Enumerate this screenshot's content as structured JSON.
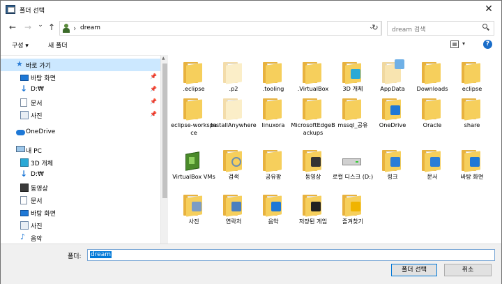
{
  "window": {
    "title": "폴더 선택",
    "close_glyph": "✕"
  },
  "nav": {
    "back_glyph": "←",
    "forward_glyph": "→",
    "dropdown_glyph": "⌄",
    "up_glyph": "↑"
  },
  "address": {
    "separator": "›",
    "path": "dream",
    "dropdown_glyph": "⌄",
    "refresh_glyph": "↻"
  },
  "search": {
    "placeholder": "dream 검색"
  },
  "toolbar": {
    "organize_label": "구성 ▾",
    "new_folder_label": "새 폴더",
    "view_dropdown": "▾",
    "help_label": "?"
  },
  "sidebar": {
    "items": [
      {
        "label": "바로 가기",
        "icon": "star-icon",
        "selected": true
      },
      {
        "label": "바탕 화면",
        "icon": "desktop-icon",
        "pinned": true
      },
      {
        "label": "D:₩",
        "icon": "download-icon",
        "pinned": true
      },
      {
        "label": "문서",
        "icon": "document-icon",
        "pinned": true
      },
      {
        "label": "사진",
        "icon": "picture-icon",
        "pinned": true
      },
      {
        "label": "OneDrive",
        "icon": "cloud-icon"
      },
      {
        "label": "내 PC",
        "icon": "pc-icon"
      },
      {
        "label": "3D 개체",
        "icon": "cube-icon"
      },
      {
        "label": "D:₩",
        "icon": "download-icon"
      },
      {
        "label": "동영상",
        "icon": "video-icon"
      },
      {
        "label": "문서",
        "icon": "document-icon"
      },
      {
        "label": "바탕 화면",
        "icon": "desktop-icon"
      },
      {
        "label": "사진",
        "icon": "picture-icon"
      },
      {
        "label": "음악",
        "icon": "music-icon"
      }
    ],
    "pin_glyph": "📌",
    "star_glyph": "★",
    "down_glyph": "↓",
    "music_glyph": "♪",
    "scroll_up_glyph": "▲"
  },
  "folders": [
    {
      "label": ".eclipse",
      "style": "normal"
    },
    {
      "label": ".p2",
      "style": "pale"
    },
    {
      "label": ".tooling",
      "style": "normal"
    },
    {
      "label": ".VirtualBox",
      "style": "normal"
    },
    {
      "label": "3D 개체",
      "style": "normal",
      "badge": "cube"
    },
    {
      "label": "AppData",
      "style": "light",
      "badge": "sync"
    },
    {
      "label": "Downloads",
      "style": "normal"
    },
    {
      "label": "eclipse",
      "style": "normal"
    },
    {
      "label": "eclipse-workspace",
      "style": "normal"
    },
    {
      "label": "InstallAnywhere",
      "style": "pale"
    },
    {
      "label": "linuxora",
      "style": "normal"
    },
    {
      "label": "MicrosoftEdgeBackups",
      "style": "normal"
    },
    {
      "label": "mssql_공유",
      "style": "normal"
    },
    {
      "label": "OneDrive",
      "style": "normal",
      "badge": "cloud"
    },
    {
      "label": "Oracle",
      "style": "normal"
    },
    {
      "label": "share",
      "style": "normal"
    },
    {
      "label": "VirtualBox VMs",
      "style": "vbox"
    },
    {
      "label": "검색",
      "style": "normal",
      "badge": "search"
    },
    {
      "label": "공유팡",
      "style": "normal"
    },
    {
      "label": "동영상",
      "style": "normal",
      "badge": "film"
    },
    {
      "label": "로컬 디스크 (D:)",
      "style": "drive"
    },
    {
      "label": "링크",
      "style": "normal",
      "badge": "link"
    },
    {
      "label": "문서",
      "style": "normal",
      "badge": "doc"
    },
    {
      "label": "바탕 화면",
      "style": "normal",
      "badge": "desktop"
    },
    {
      "label": "사진",
      "style": "normal",
      "badge": "photo"
    },
    {
      "label": "연락처",
      "style": "normal",
      "badge": "contact"
    },
    {
      "label": "음악",
      "style": "normal",
      "badge": "music"
    },
    {
      "label": "저장된 게임",
      "style": "normal",
      "badge": "chess"
    },
    {
      "label": "즐겨찾기",
      "style": "normal",
      "badge": "star"
    }
  ],
  "footer": {
    "folder_label": "폴더:",
    "folder_value": "dream",
    "select_button": "폴더 선택",
    "cancel_button": "취소"
  },
  "colors": {
    "accent": "#0078d7",
    "folder": "#f6cf5c",
    "selected_nav": "#cce8ff"
  }
}
